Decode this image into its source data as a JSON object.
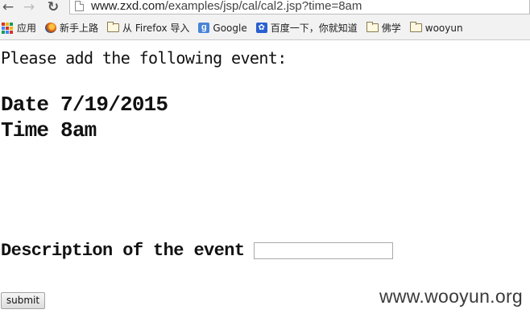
{
  "browser": {
    "url_host": "www.zxd.com",
    "url_path": "/examples/jsp/cal/cal2.jsp?time=8am"
  },
  "bookmarks": [
    {
      "label": "应用",
      "icon": "apps-icon"
    },
    {
      "label": "新手上路",
      "icon": "firefox-icon"
    },
    {
      "label": "从 Firefox 导入",
      "icon": "folder-icon"
    },
    {
      "label": "Google",
      "icon": "google-icon"
    },
    {
      "label": "百度一下，你就知道",
      "icon": "baidu-paw-icon"
    },
    {
      "label": "佛学",
      "icon": "folder-icon"
    },
    {
      "label": "wooyun",
      "icon": "folder-icon"
    }
  ],
  "page": {
    "intro": "Please add the following event:",
    "date_line": "Date 7/19/2015",
    "time_line": "Time 8am",
    "description_label": "Description of the event",
    "description_value": "",
    "submit_label": "submit"
  },
  "watermark": "www.wooyun.org"
}
